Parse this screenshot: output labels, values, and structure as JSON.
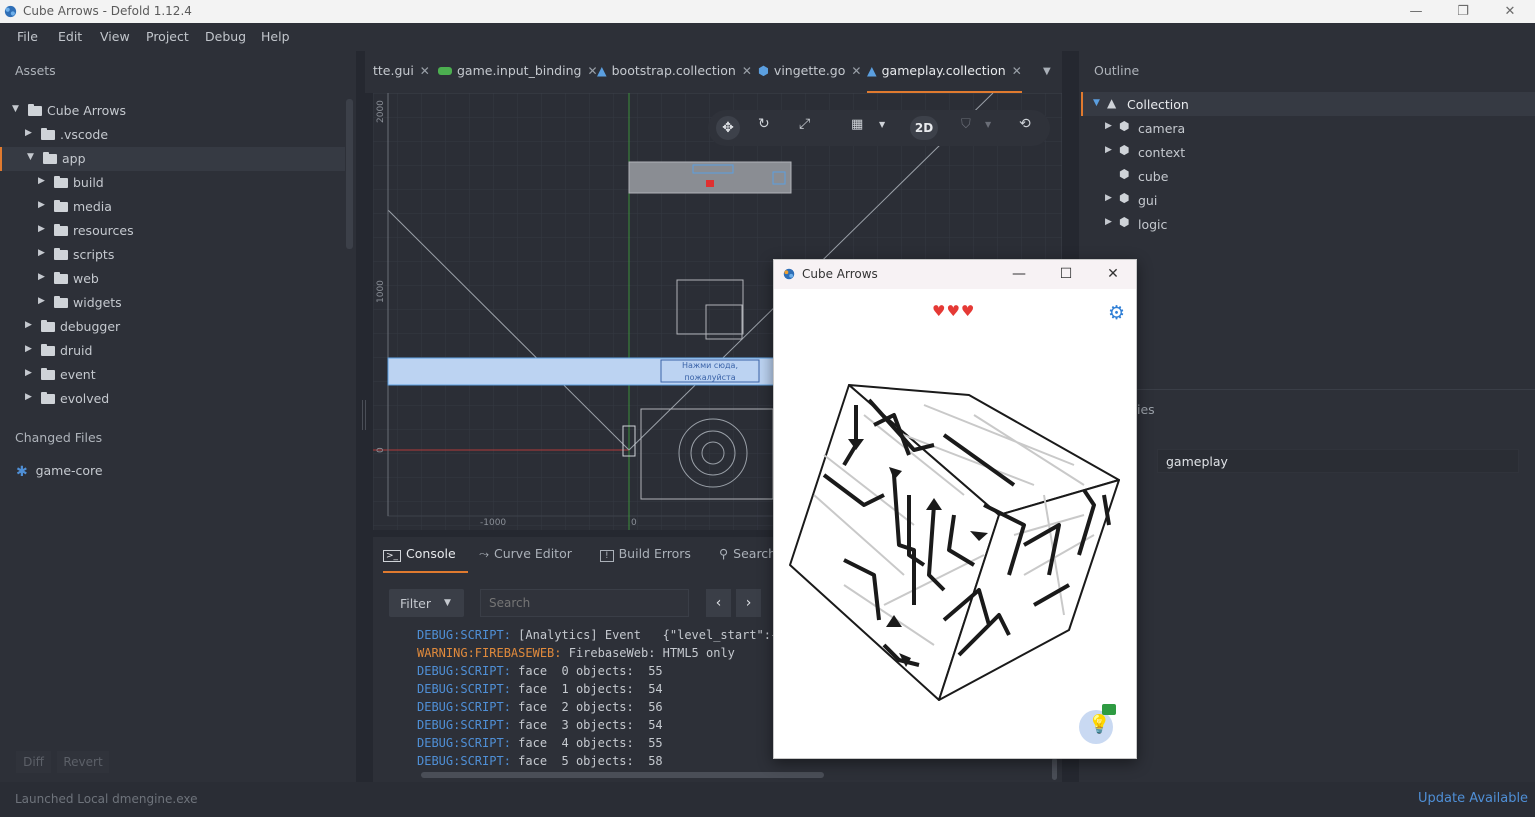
{
  "window": {
    "title": "Cube Arrows - Defold 1.12.4"
  },
  "menu": [
    "File",
    "Edit",
    "View",
    "Project",
    "Debug",
    "Help"
  ],
  "assets": {
    "title": "Assets",
    "tree": [
      {
        "label": "Cube Arrows",
        "depth": 0,
        "open": true
      },
      {
        "label": ".vscode",
        "depth": 1,
        "open": false
      },
      {
        "label": "app",
        "depth": 1,
        "open": true,
        "selected": true
      },
      {
        "label": "build",
        "depth": 2,
        "open": false
      },
      {
        "label": "media",
        "depth": 2,
        "open": false
      },
      {
        "label": "resources",
        "depth": 2,
        "open": false
      },
      {
        "label": "scripts",
        "depth": 2,
        "open": false
      },
      {
        "label": "web",
        "depth": 2,
        "open": false
      },
      {
        "label": "widgets",
        "depth": 2,
        "open": false
      },
      {
        "label": "debugger",
        "depth": 1,
        "open": false
      },
      {
        "label": "druid",
        "depth": 1,
        "open": false
      },
      {
        "label": "event",
        "depth": 1,
        "open": false
      },
      {
        "label": "evolved",
        "depth": 1,
        "open": false
      }
    ],
    "changed_title": "Changed Files",
    "changed_items": [
      "game-core"
    ],
    "diff_label": "Diff",
    "revert_label": "Revert"
  },
  "tabs": [
    {
      "label": "tte.gui",
      "icon": "none"
    },
    {
      "label": "game.input_binding",
      "icon": "gamepad-icon"
    },
    {
      "label": "bootstrap.collection",
      "icon": "collection-icon"
    },
    {
      "label": "vingette.go",
      "icon": "cube-icon"
    },
    {
      "label": "gameplay.collection",
      "icon": "collection-icon",
      "active": true
    }
  ],
  "toolbar": {
    "mode_2d": "2D"
  },
  "viewport": {
    "ruler_y": [
      "2000",
      "1000",
      "0"
    ],
    "ruler_x": [
      "-1000",
      "0"
    ],
    "button_text": "Нажми сюда,\nпожалуйста"
  },
  "bottom_tabs": [
    "Console",
    "Curve Editor",
    "Build Errors",
    "Search"
  ],
  "console": {
    "filter_label": "Filter",
    "search_placeholder": "Search",
    "lines": [
      {
        "tag": "DEBUG:SCRIPT:",
        "kind": "dbg",
        "text": " [Analytics] Event   {\"level_start\":{"
      },
      {
        "tag": "WARNING:FIREBASEWEB:",
        "kind": "wrn",
        "text": " FirebaseWeb: HTML5 only"
      },
      {
        "tag": "DEBUG:SCRIPT:",
        "kind": "dbg",
        "text": " face  0 objects:  55"
      },
      {
        "tag": "DEBUG:SCRIPT:",
        "kind": "dbg",
        "text": " face  1 objects:  54"
      },
      {
        "tag": "DEBUG:SCRIPT:",
        "kind": "dbg",
        "text": " face  2 objects:  56"
      },
      {
        "tag": "DEBUG:SCRIPT:",
        "kind": "dbg",
        "text": " face  3 objects:  54"
      },
      {
        "tag": "DEBUG:SCRIPT:",
        "kind": "dbg",
        "text": " face  4 objects:  55"
      },
      {
        "tag": "DEBUG:SCRIPT:",
        "kind": "dbg",
        "text": " face  5 objects:  58"
      }
    ]
  },
  "outline": {
    "title": "Outline",
    "root": "Collection",
    "items": [
      {
        "label": "camera",
        "expandable": true
      },
      {
        "label": "context",
        "expandable": true
      },
      {
        "label": "cube",
        "expandable": false
      },
      {
        "label": "gui",
        "expandable": true
      },
      {
        "label": "logic",
        "expandable": true
      }
    ],
    "properties_partial": "ies",
    "id_value": "gameplay"
  },
  "status": {
    "left": "Launched Local dmengine.exe",
    "right": "Update Available"
  },
  "game_window": {
    "title": "Cube Arrows",
    "lives": "♥♥♥"
  },
  "colors": {
    "accent": "#e07a2f",
    "link": "#4f8fd6",
    "bg": "#2d3038",
    "heart": "#e53935"
  }
}
